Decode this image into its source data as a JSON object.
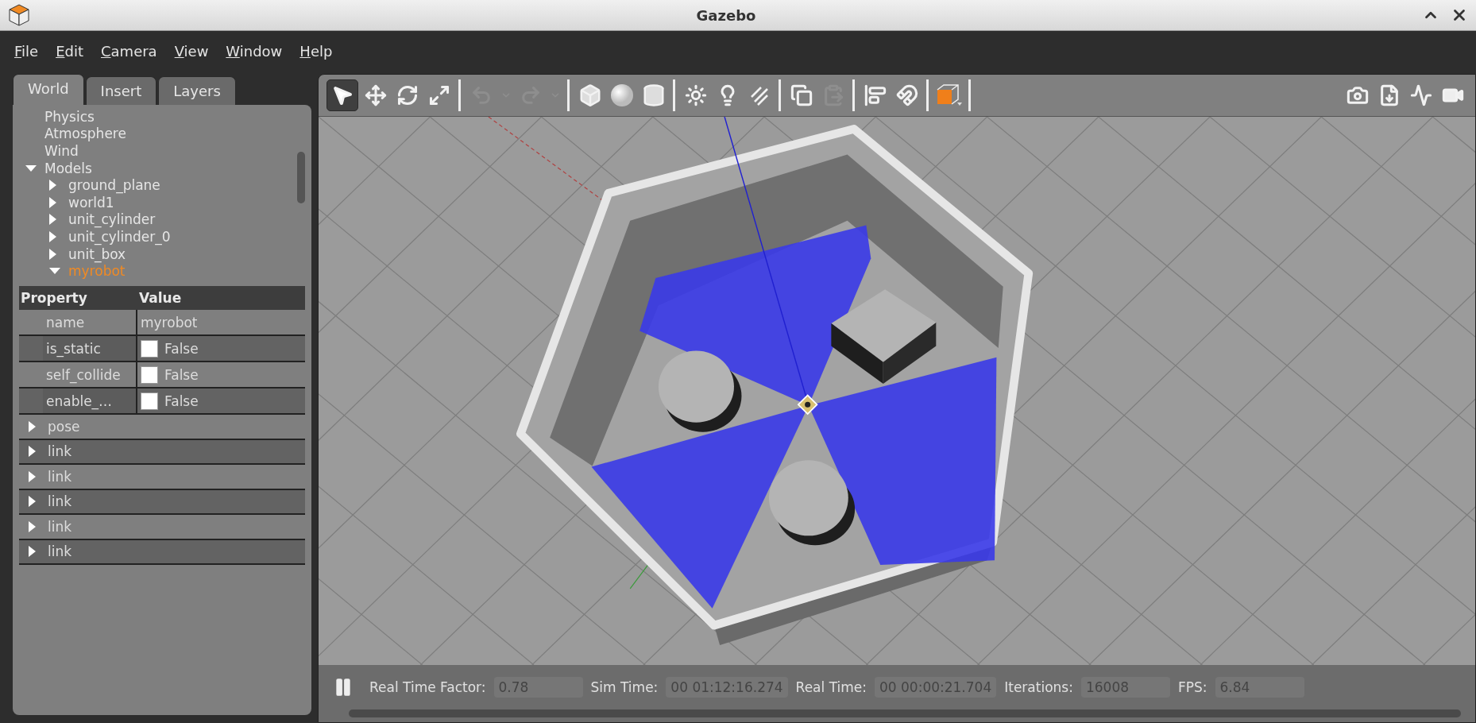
{
  "window": {
    "title": "Gazebo"
  },
  "menu": [
    "File",
    "Edit",
    "Camera",
    "View",
    "Window",
    "Help"
  ],
  "tabs": [
    {
      "label": "World",
      "selected": true
    },
    {
      "label": "Insert",
      "selected": false
    },
    {
      "label": "Layers",
      "selected": false
    }
  ],
  "tree": [
    {
      "label": "Physics",
      "kind": "leaf",
      "selected": false
    },
    {
      "label": "Atmosphere",
      "kind": "leaf",
      "selected": false
    },
    {
      "label": "Wind",
      "kind": "leaf",
      "selected": false
    },
    {
      "label": "Models",
      "kind": "group",
      "expanded": true,
      "selected": false,
      "children": [
        {
          "label": "ground_plane",
          "kind": "group",
          "expanded": false,
          "selected": false
        },
        {
          "label": "world1",
          "kind": "group",
          "expanded": false,
          "selected": false
        },
        {
          "label": "unit_cylinder",
          "kind": "group",
          "expanded": false,
          "selected": false
        },
        {
          "label": "unit_cylinder_0",
          "kind": "group",
          "expanded": false,
          "selected": false
        },
        {
          "label": "unit_box",
          "kind": "group",
          "expanded": false,
          "selected": false
        },
        {
          "label": "myrobot",
          "kind": "group",
          "expanded": true,
          "selected": true
        }
      ]
    }
  ],
  "properties": {
    "columns": [
      "Property",
      "Value"
    ],
    "rows": [
      {
        "name": "name",
        "kind": "text",
        "value": "myrobot"
      },
      {
        "name": "is_static",
        "kind": "checkbox",
        "checked": false,
        "value": "False"
      },
      {
        "name": "self_collide",
        "kind": "checkbox",
        "checked": false,
        "value": "False"
      },
      {
        "name": "enable_…",
        "kind": "checkbox",
        "checked": false,
        "value": "False"
      }
    ],
    "sections": [
      {
        "label": "pose",
        "expanded": false
      },
      {
        "label": "link",
        "expanded": false
      },
      {
        "label": "link",
        "expanded": false
      },
      {
        "label": "link",
        "expanded": false
      },
      {
        "label": "link",
        "expanded": false
      },
      {
        "label": "link",
        "expanded": false
      }
    ]
  },
  "toolbar": {
    "groups": [
      [
        {
          "kind": "select",
          "selected": true,
          "disabled": false
        },
        {
          "kind": "translate",
          "selected": false,
          "disabled": false
        },
        {
          "kind": "rotate",
          "selected": false,
          "disabled": false
        },
        {
          "kind": "scale",
          "selected": false,
          "disabled": false
        }
      ],
      [
        {
          "kind": "undo",
          "selected": false,
          "disabled": true
        },
        {
          "kind": "dropdown",
          "selected": false,
          "disabled": true
        },
        {
          "kind": "redo",
          "selected": false,
          "disabled": true
        },
        {
          "kind": "dropdown",
          "selected": false,
          "disabled": true
        }
      ],
      [
        {
          "kind": "box",
          "selected": false,
          "disabled": false
        },
        {
          "kind": "sphere",
          "selected": false,
          "disabled": false
        },
        {
          "kind": "cylinder",
          "selected": false,
          "disabled": false
        }
      ],
      [
        {
          "kind": "point-light",
          "selected": false,
          "disabled": false
        },
        {
          "kind": "spot-light",
          "selected": false,
          "disabled": false
        },
        {
          "kind": "directional-light",
          "selected": false,
          "disabled": false
        }
      ],
      [
        {
          "kind": "copy",
          "selected": false,
          "disabled": false
        },
        {
          "kind": "paste",
          "selected": false,
          "disabled": true
        }
      ],
      [
        {
          "kind": "align",
          "selected": false,
          "disabled": false
        },
        {
          "kind": "snap",
          "selected": false,
          "disabled": false
        }
      ],
      [
        {
          "kind": "view-angle",
          "selected": false,
          "disabled": false
        }
      ]
    ],
    "right": [
      {
        "kind": "screenshot",
        "selected": false,
        "disabled": false
      },
      {
        "kind": "log",
        "selected": false,
        "disabled": false
      },
      {
        "kind": "plot",
        "selected": false,
        "disabled": false
      },
      {
        "kind": "video",
        "selected": false,
        "disabled": false
      }
    ]
  },
  "status_bar": {
    "paused": false,
    "fields": [
      {
        "label": "Real Time Factor:",
        "value": "0.78"
      },
      {
        "label": "Sim Time:",
        "value": "00 01:12:16.274"
      },
      {
        "label": "Real Time:",
        "value": "00 00:00:21.704"
      },
      {
        "label": "Iterations:",
        "value": "16008"
      },
      {
        "label": "FPS:",
        "value": "6.84"
      }
    ]
  }
}
